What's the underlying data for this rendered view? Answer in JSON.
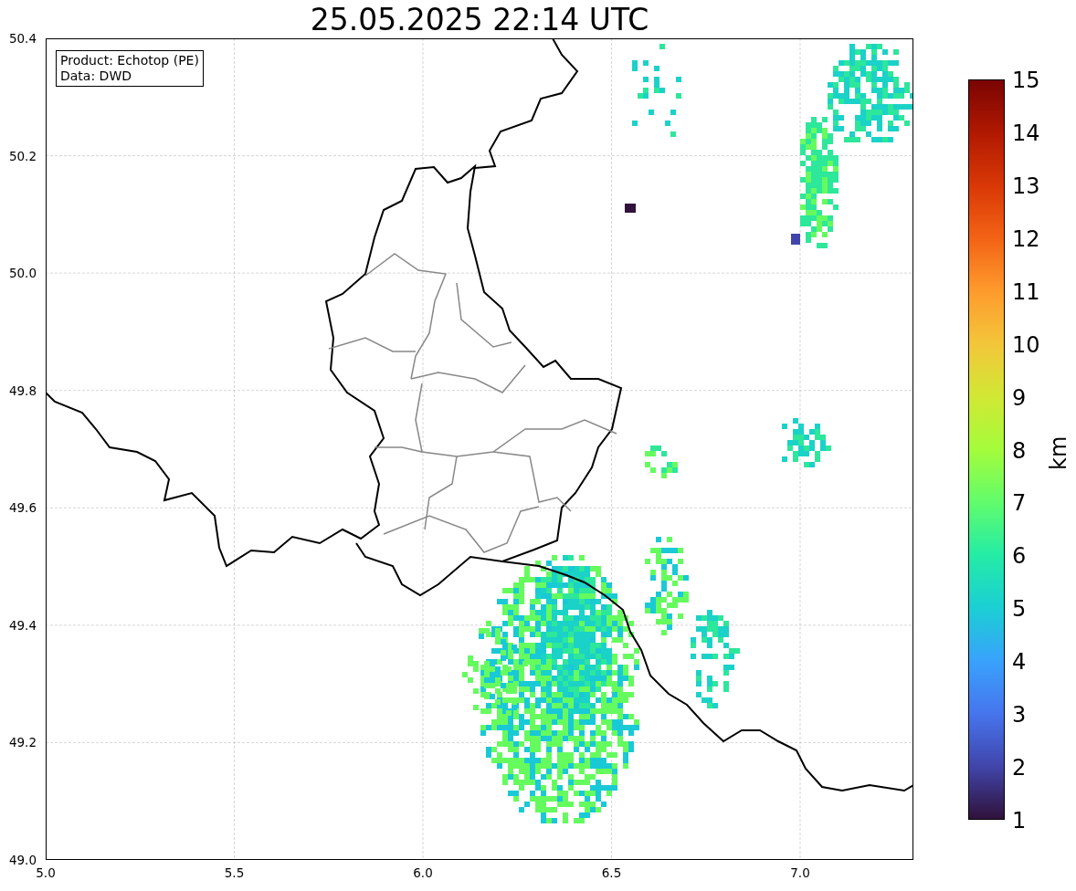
{
  "title": "25.05.2025 22:14 UTC",
  "info_box": {
    "lines": [
      "Product: Echotop (PE)",
      "Data: DWD"
    ]
  },
  "map": {
    "xticks": [
      "5.0",
      "5.5",
      "6.0",
      "6.5",
      "7.0"
    ],
    "yticks": [
      "50.4",
      "50.2",
      "50.0",
      "49.8",
      "49.6",
      "49.4",
      "49.2",
      "49.0"
    ]
  },
  "colorbar": {
    "label": "km",
    "ticks": [
      "15",
      "14",
      "13",
      "12",
      "11",
      "10",
      "9",
      "8",
      "7",
      "6",
      "5",
      "4",
      "3",
      "2",
      "1"
    ]
  }
}
